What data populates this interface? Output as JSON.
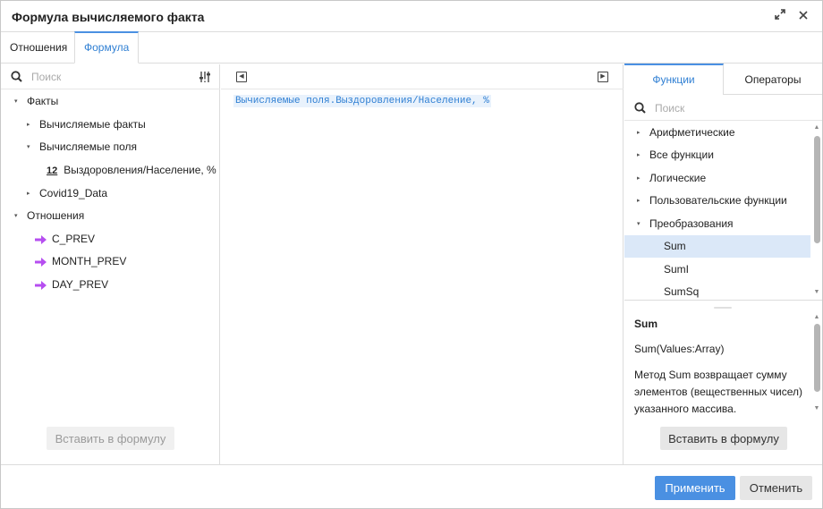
{
  "dialog": {
    "title": "Формула вычисляемого факта"
  },
  "top_tabs": [
    {
      "label": "Отношения",
      "active": false
    },
    {
      "label": "Формула",
      "active": true
    }
  ],
  "left_panel": {
    "search_placeholder": "Поиск",
    "tree": [
      {
        "label": "Факты",
        "caret": "▾"
      },
      {
        "label": "Вычисляемые факты",
        "caret": "▸"
      },
      {
        "label": "Вычисляемые поля",
        "caret": "▾"
      },
      {
        "label": "Выздоровления/Население, %",
        "icon_text": "12"
      },
      {
        "label": "Covid19_Data",
        "caret": "▸"
      },
      {
        "label": "Отношения",
        "caret": "▾"
      },
      {
        "label": "C_PREV"
      },
      {
        "label": "MONTH_PREV"
      },
      {
        "label": "DAY_PREV"
      }
    ],
    "insert_button": "Вставить в формулу"
  },
  "editor": {
    "formula": "Вычисляемые поля.Выздоровления/Население, %"
  },
  "right_panel": {
    "tabs": [
      {
        "label": "Функции",
        "active": true
      },
      {
        "label": "Операторы",
        "active": false
      }
    ],
    "search_placeholder": "Поиск",
    "functions": [
      {
        "label": "Арифметические",
        "caret": "▸"
      },
      {
        "label": "Все функции",
        "caret": "▸"
      },
      {
        "label": "Логические",
        "caret": "▸"
      },
      {
        "label": "Пользовательские функции",
        "caret": "▸"
      },
      {
        "label": "Преобразования",
        "caret": "▾"
      },
      {
        "label": "Sum",
        "selected": true
      },
      {
        "label": "SumI"
      },
      {
        "label": "SumSq"
      }
    ],
    "description": {
      "title": "Sum",
      "signature": "Sum(Values:Array)",
      "text": "Метод Sum возвращает сумму элементов (вещественных чисел) указанного массива."
    },
    "insert_button": "Вставить в формулу"
  },
  "footer": {
    "apply_button": "Применить",
    "cancel_button": "Отменить"
  },
  "colors": {
    "accent": "#4a90e2",
    "selected_bg": "#dbe8f8",
    "relation_arrow": "#b64ef0"
  }
}
